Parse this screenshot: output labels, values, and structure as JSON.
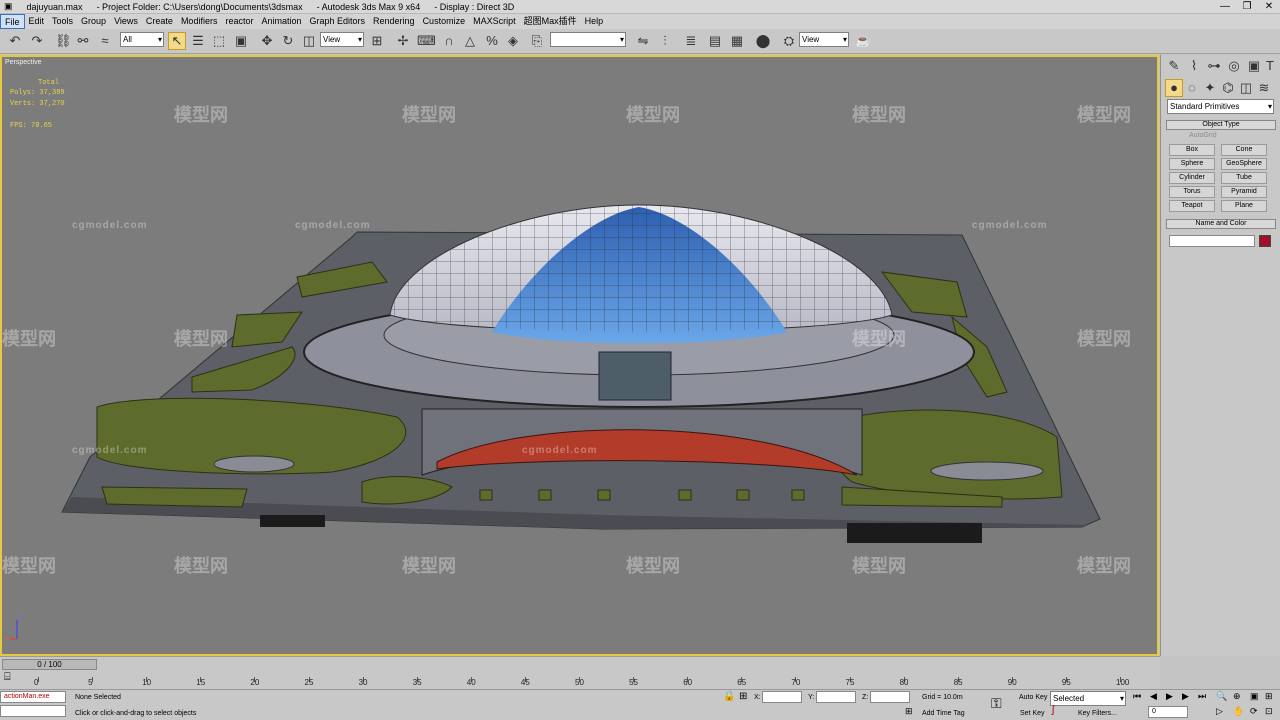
{
  "titlebar": {
    "file": "dajuyuan.max",
    "project": "- Project Folder: C:\\Users\\dong\\Documents\\3dsmax",
    "app": "- Autodesk 3ds Max 9 x64",
    "display": "- Display : Direct 3D",
    "min": "—",
    "max": "❐",
    "close": "✕"
  },
  "menu": [
    "File",
    "Edit",
    "Tools",
    "Group",
    "Views",
    "Create",
    "Modifiers",
    "reactor",
    "Animation",
    "Graph Editors",
    "Rendering",
    "Customize",
    "MAXScript",
    "超图Max插件",
    "Help"
  ],
  "toolbar": {
    "selection_filter": "All",
    "ref_coord": "View",
    "named_sel": "",
    "render_type": "View"
  },
  "viewport": {
    "label": "Perspective",
    "stats": {
      "total_label": "Total",
      "polys": "Polys: 37,389",
      "verts": "Verts: 37,270",
      "fps": "FPS:   78.65"
    },
    "axis_x": "x",
    "axis_z": "z"
  },
  "watermark": {
    "logo_text": "模型网",
    "site": "cgmodel.com"
  },
  "command_panel": {
    "category": "Standard Primitives",
    "object_type_title": "Object Type",
    "autogrid": "AutoGrid",
    "buttons": [
      "Box",
      "Cone",
      "Sphere",
      "GeoSphere",
      "Cylinder",
      "Tube",
      "Torus",
      "Pyramid",
      "Teapot",
      "Plane"
    ],
    "name_color_title": "Name and Color",
    "name_value": "",
    "color": "#a0102c"
  },
  "timeline": {
    "frame_counter": "0 / 100",
    "ticks": [
      "0",
      "5",
      "10",
      "15",
      "20",
      "25",
      "30",
      "35",
      "40",
      "45",
      "50",
      "55",
      "60",
      "65",
      "70",
      "75",
      "80",
      "85",
      "90",
      "95",
      "100"
    ]
  },
  "status": {
    "script_listener": "actionMan.exe",
    "selection": "None Selected",
    "prompt": "Click or click-and-drag to select objects",
    "x_label": "X:",
    "y_label": "Y:",
    "z_label": "Z:",
    "grid": "Grid = 10.0m",
    "add_time_tag": "Add Time Tag",
    "auto_key": "Auto Key",
    "set_key": "Set Key",
    "key_mode": "Selected",
    "key_filters": "Key Filters...",
    "frame": "0"
  }
}
